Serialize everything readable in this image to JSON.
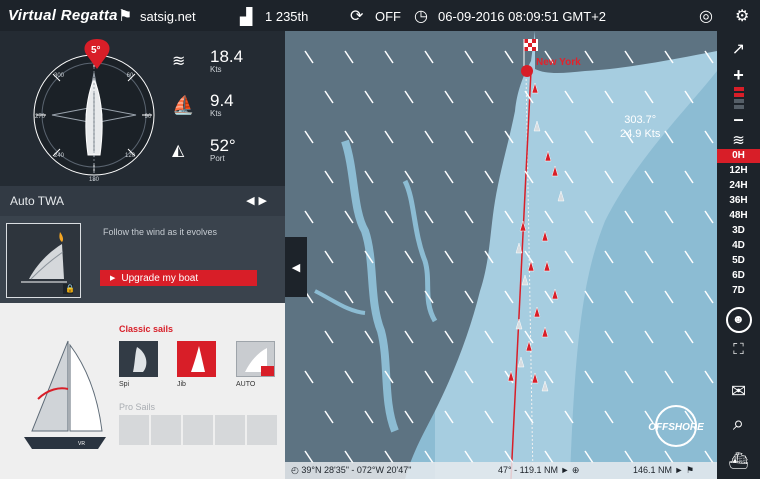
{
  "topbar": {
    "brand": "Virtual Regatta",
    "site": "satsig.net",
    "rank": "1 235th",
    "sync_state": "OFF",
    "datetime": "06-09-2016 08:09:51 GMT+2"
  },
  "instruments": {
    "heading_badge": "5°",
    "wind_speed": "18.4",
    "wind_speed_unit": "Kts",
    "boat_speed": "9.4",
    "boat_speed_unit": "Kts",
    "twa": "52°",
    "twa_side": "Port",
    "compass_ticks": [
      "300",
      "330",
      "0",
      "30",
      "60",
      "270",
      "240",
      "210",
      "180",
      "150",
      "120",
      "90"
    ]
  },
  "autopilot": {
    "mode_label": "Auto TWA",
    "prev": "◀",
    "next": "▶",
    "description": "Follow the wind as it evolves",
    "upgrade_label": "Upgrade my boat"
  },
  "sails": {
    "classic_title": "Classic sails",
    "items": [
      {
        "label": "Spi",
        "state": "available"
      },
      {
        "label": "Jib",
        "state": "active"
      },
      {
        "label": "AUTO",
        "state": "locked"
      }
    ],
    "pro_title": "Pro Sails"
  },
  "map": {
    "destination": "New York",
    "wind_direction": "303.7°",
    "wind_speed": "24.9 Kts",
    "cursor_coords": "39°N 28'35\" - 072°W 20'47\"",
    "heading_distance": "47° - 119.1 NM",
    "distance_to_finish": "146.1 NM",
    "logo": "OFFSHORE"
  },
  "timeline": [
    "0H",
    "12H",
    "24H",
    "36H",
    "48H",
    "3D",
    "4D",
    "5D",
    "6D",
    "7D"
  ],
  "timeline_active": "0H",
  "colors": {
    "accent": "#d81e28",
    "sea_deep": "#8cbcd3",
    "sea_shelf": "#a6cde0",
    "land": "#5d7382",
    "panel": "#242b33"
  }
}
